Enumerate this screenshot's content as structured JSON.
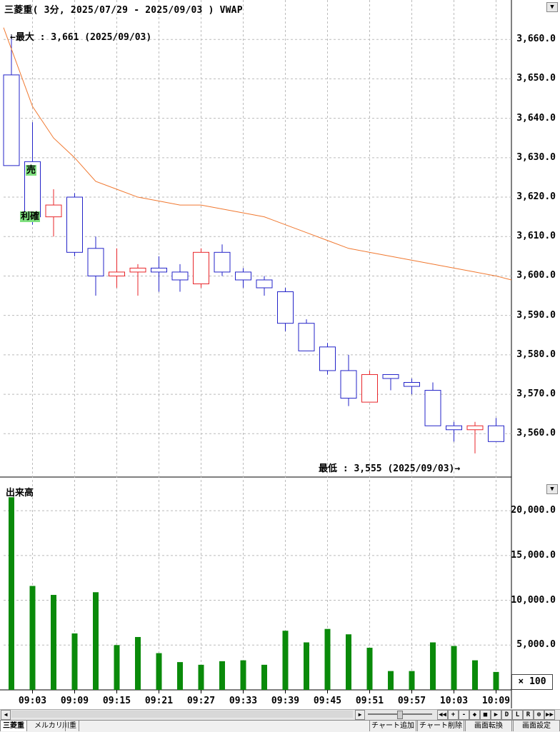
{
  "title": "三菱重( 3分, 2025/07/29 - 2025/09/03 )  VWAP",
  "annotations": {
    "max": "←最大 : 3,661 (2025/09/03)",
    "min": "最低 : 3,555 (2025/09/03)→",
    "sell": "売",
    "confirm": "利確"
  },
  "volume_title": "出来高",
  "multiplier": "× 100",
  "scroll": {
    "toolbar": [
      "◀◀",
      "+",
      "-",
      "◆",
      "■",
      "▶",
      "D",
      "L",
      "R",
      "⊕",
      "▶▶"
    ]
  },
  "bottom": {
    "tabs": [
      "三菱重",
      "メルカリ",
      "川重"
    ],
    "actions": [
      "チャート追加",
      "チャート削除",
      "画面転換",
      "画面設定"
    ]
  },
  "colors": {
    "up": "#e8262a",
    "down": "#2323c8",
    "vwap": "#f07830",
    "volume": "#0a8a0a"
  },
  "chart_data": [
    {
      "type": "candlestick",
      "title": "三菱重( 3分, 2025/07/29 - 2025/09/03 )  VWAP",
      "y_ticks": [
        3560,
        3570,
        3580,
        3590,
        3600,
        3610,
        3620,
        3630,
        3640,
        3650,
        3660
      ],
      "y_tick_labels": [
        "3,560.0",
        "3,570.0",
        "3,580.0",
        "3,590.0",
        "3,600.0",
        "3,610.0",
        "3,620.0",
        "3,630.0",
        "3,640.0",
        "3,650.0",
        "3,660.0"
      ],
      "ylim": [
        3549,
        3670
      ],
      "x_tick_labels": [
        "09:03",
        "09:09",
        "09:15",
        "09:21",
        "09:27",
        "09:33",
        "09:39",
        "09:45",
        "09:51",
        "09:57",
        "10:03",
        "10:09"
      ],
      "candles": [
        {
          "o": 3651,
          "h": 3661,
          "l": 3630,
          "c": 3628
        },
        {
          "o": 3629,
          "h": 3639,
          "l": 3613,
          "c": 3615
        },
        {
          "o": 3615,
          "h": 3622,
          "l": 3610,
          "c": 3618
        },
        {
          "o": 3620,
          "h": 3621,
          "l": 3605,
          "c": 3606
        },
        {
          "o": 3607,
          "h": 3610,
          "l": 3595,
          "c": 3600
        },
        {
          "o": 3600,
          "h": 3607,
          "l": 3597,
          "c": 3601
        },
        {
          "o": 3601,
          "h": 3603,
          "l": 3595,
          "c": 3602
        },
        {
          "o": 3602,
          "h": 3605,
          "l": 3596,
          "c": 3601
        },
        {
          "o": 3601,
          "h": 3603,
          "l": 3596,
          "c": 3599
        },
        {
          "o": 3598,
          "h": 3607,
          "l": 3597,
          "c": 3606
        },
        {
          "o": 3606,
          "h": 3608,
          "l": 3600,
          "c": 3601
        },
        {
          "o": 3601,
          "h": 3602,
          "l": 3597,
          "c": 3599
        },
        {
          "o": 3599,
          "h": 3600,
          "l": 3595,
          "c": 3597
        },
        {
          "o": 3596,
          "h": 3597,
          "l": 3586,
          "c": 3588
        },
        {
          "o": 3588,
          "h": 3589,
          "l": 3581,
          "c": 3581
        },
        {
          "o": 3582,
          "h": 3583,
          "l": 3575,
          "c": 3576
        },
        {
          "o": 3576,
          "h": 3580,
          "l": 3567,
          "c": 3569
        },
        {
          "o": 3568,
          "h": 3576,
          "l": 3568,
          "c": 3575
        },
        {
          "o": 3575,
          "h": 3575,
          "l": 3571,
          "c": 3574
        },
        {
          "o": 3573,
          "h": 3574,
          "l": 3570,
          "c": 3572
        },
        {
          "o": 3571,
          "h": 3573,
          "l": 3562,
          "c": 3562
        },
        {
          "o": 3562,
          "h": 3563,
          "l": 3558,
          "c": 3561
        },
        {
          "o": 3561,
          "h": 3563,
          "l": 3555,
          "c": 3562
        },
        {
          "o": 3562,
          "h": 3564,
          "l": 3558,
          "c": 3558
        }
      ],
      "vwap": [
        3663,
        3643,
        3635,
        3630,
        3624,
        3622,
        3620,
        3619,
        3618,
        3618,
        3617,
        3616,
        3615,
        3613,
        3611,
        3609,
        3607,
        3606,
        3605,
        3604,
        3603,
        3602,
        3601,
        3600
      ]
    },
    {
      "type": "bar",
      "title": "出来高",
      "multiplier_label": "× 100",
      "y_ticks": [
        5000,
        10000,
        15000,
        20000
      ],
      "y_tick_labels": [
        "5,000.0",
        "10,000.0",
        "15,000.0",
        "20,000.0"
      ],
      "ylim": [
        0,
        22000
      ],
      "values": [
        21500,
        11600,
        10600,
        6300,
        10900,
        5000,
        5900,
        4100,
        3100,
        2800,
        3200,
        3300,
        2800,
        6600,
        5300,
        6800,
        6200,
        4700,
        2100,
        2100,
        5300,
        4900,
        3300,
        2000
      ]
    }
  ]
}
